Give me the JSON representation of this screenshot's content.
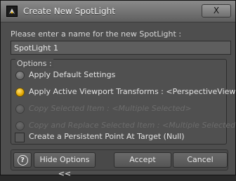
{
  "window": {
    "title": "Create New SpotLight",
    "close_label": "X"
  },
  "form": {
    "prompt": "Please enter a name for the new SpotLight :",
    "name_value": "SpotLight 1"
  },
  "options": {
    "legend": "Options :",
    "items": [
      {
        "label": "Apply Default Settings",
        "state": "unchecked"
      },
      {
        "label": "Apply Active Viewport Transforms : <PerspectiveView>",
        "state": "checked"
      },
      {
        "label": "Copy Selected Item : <Multiple Selected>",
        "state": "disabled"
      },
      {
        "label": "Copy and Replace Selected Item : <Multiple Selected>",
        "state": "disabled"
      }
    ]
  },
  "persistent_point": {
    "label": "Create a Persistent Point At Target (Null)",
    "checked": false
  },
  "buttons": {
    "help": "?",
    "hide_options": "Hide Options <<",
    "accept": "Accept",
    "cancel": "Cancel"
  },
  "colors": {
    "radio_selected": "#f0b400"
  }
}
